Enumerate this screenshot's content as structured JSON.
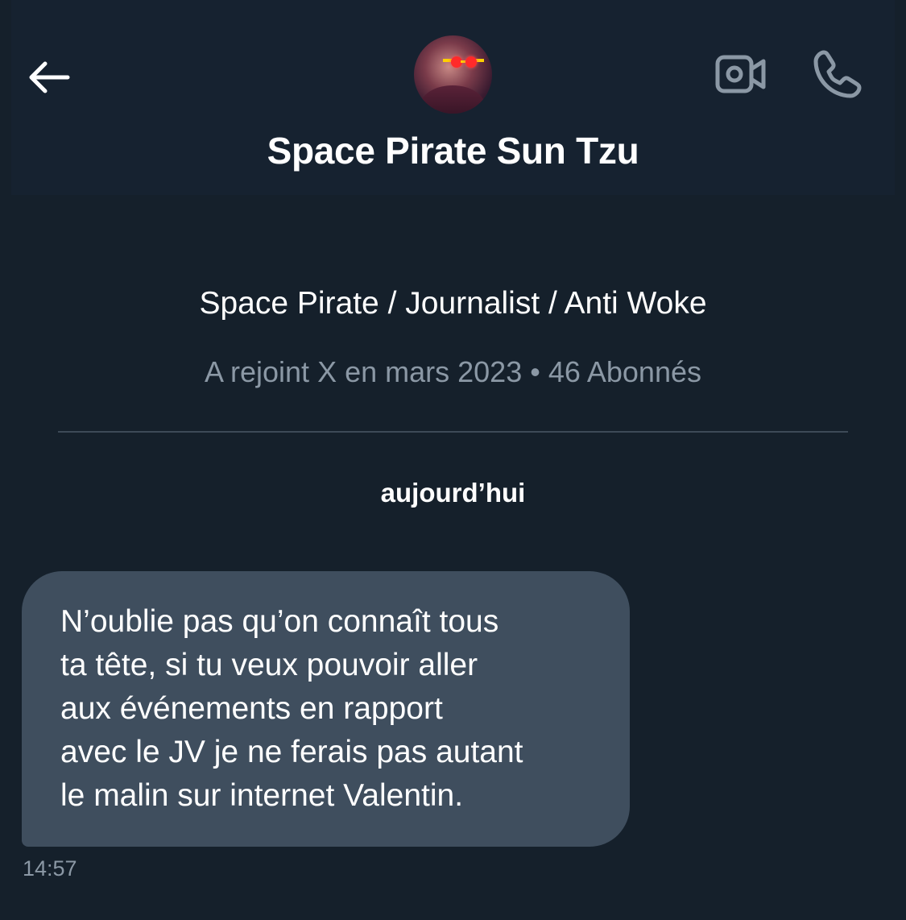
{
  "header": {
    "back_icon": "arrow-left-icon",
    "avatar_icon": "profile-avatar",
    "video_icon": "video-camera-icon",
    "call_icon": "phone-icon",
    "name": "Space Pirate Sun Tzu"
  },
  "profile": {
    "bio": "Space Pirate / Journalist / Anti Woke",
    "meta": "A rejoint X en mars 2023 • 46 Abonnés"
  },
  "conversation": {
    "date_separator": "aujourd’hui",
    "messages": [
      {
        "text": "N’oublie pas qu’on connaît tous\nta tête, si tu veux pouvoir aller\naux événements en rapport\navec le JV je ne ferais pas autant\nle malin sur internet Valentin.",
        "time": "14:57"
      }
    ]
  },
  "colors": {
    "background": "#15202b",
    "bubble": "#3f4e5e",
    "muted_text": "#8b98a5",
    "icon_gray": "#8b98a5"
  }
}
